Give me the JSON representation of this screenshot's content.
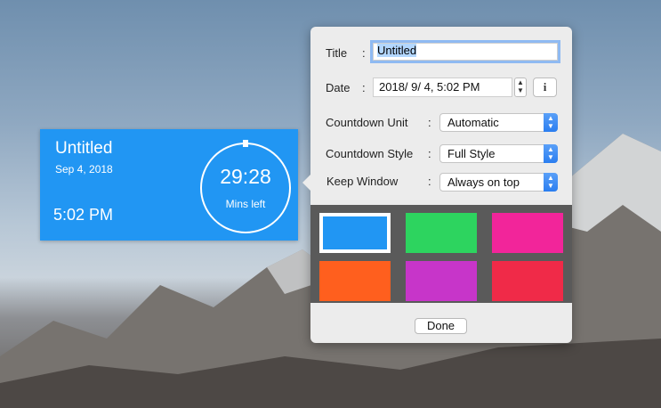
{
  "widget": {
    "title": "Untitled",
    "date": "Sep 4, 2018",
    "time": "5:02 PM",
    "countdown": "29:28",
    "countdown_label": "Mins left",
    "color": "#2196f3"
  },
  "popover": {
    "title_label": "Title",
    "title_value": "Untitled",
    "date_label": "Date",
    "date_value": "2018/  9/  4,   5:02 PM",
    "info_glyph": "i",
    "unit_label": "Countdown Unit",
    "unit_value": "Automatic",
    "style_label": "Countdown Style",
    "style_value": "Full Style",
    "keep_label": "Keep Window",
    "keep_value": "Always on top",
    "colon": ":",
    "done_label": "Done",
    "swatches": [
      "#2196f3",
      "#2dd45f",
      "#f2259a",
      "#ff5f1e",
      "#c735c9",
      "#f02a48"
    ],
    "selected_swatch": 0
  },
  "icons": {
    "stepper": "stepper-icon",
    "info": "info-icon",
    "popup": "popup-chevrons-icon"
  }
}
